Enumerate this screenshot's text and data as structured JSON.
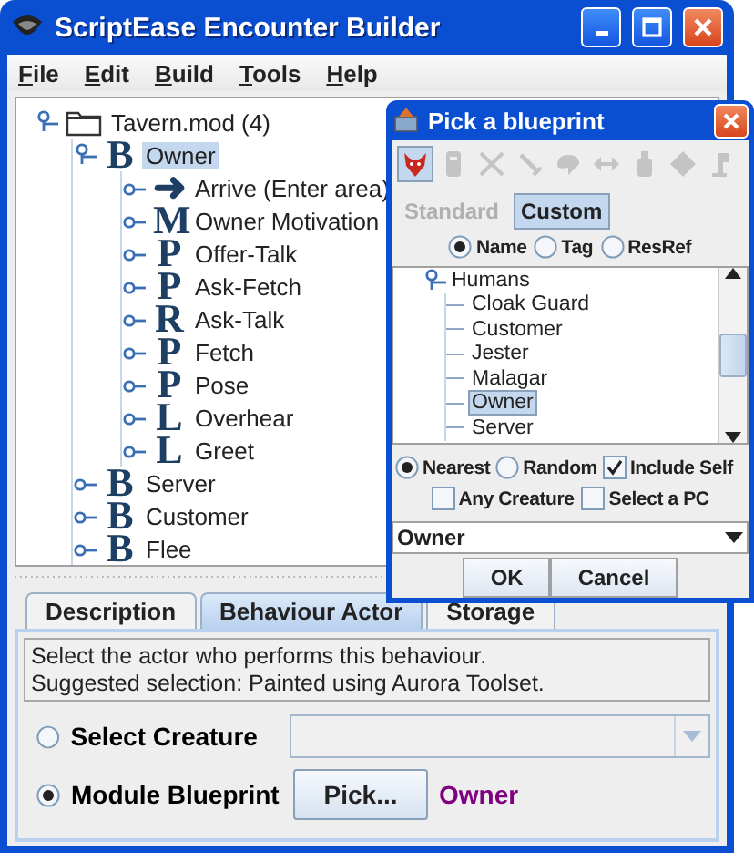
{
  "window": {
    "title": "ScriptEase Encounter Builder"
  },
  "menu": [
    "File",
    "Edit",
    "Build",
    "Tools",
    "Help"
  ],
  "tree": {
    "label": "Tavern.mod (4)",
    "kind": "folder",
    "expanded": true,
    "selected": false,
    "children": [
      {
        "label": "Owner",
        "kind": "glyph",
        "glyph": "B",
        "expanded": true,
        "selected": true,
        "children": [
          {
            "label": "Arrive (Enter area)",
            "kind": "glyph",
            "glyph": "➜",
            "expanded": false,
            "selected": false
          },
          {
            "label": "Owner Motivation",
            "kind": "glyph",
            "glyph": "M",
            "expanded": false,
            "selected": false
          },
          {
            "label": "Offer-Talk",
            "kind": "glyph",
            "glyph": "P",
            "expanded": false,
            "selected": false
          },
          {
            "label": "Ask-Fetch",
            "kind": "glyph",
            "glyph": "P",
            "expanded": false,
            "selected": false
          },
          {
            "label": "Ask-Talk",
            "kind": "glyph",
            "glyph": "R",
            "expanded": false,
            "selected": false
          },
          {
            "label": "Fetch",
            "kind": "glyph",
            "glyph": "P",
            "expanded": false,
            "selected": false
          },
          {
            "label": "Pose",
            "kind": "glyph",
            "glyph": "P",
            "expanded": false,
            "selected": false
          },
          {
            "label": "Overhear",
            "kind": "glyph",
            "glyph": "L",
            "expanded": false,
            "selected": false
          },
          {
            "label": "Greet",
            "kind": "glyph",
            "glyph": "L",
            "expanded": false,
            "selected": false
          }
        ]
      },
      {
        "label": "Server",
        "kind": "glyph",
        "glyph": "B",
        "expanded": false,
        "selected": false
      },
      {
        "label": "Customer",
        "kind": "glyph",
        "glyph": "B",
        "expanded": false,
        "selected": false
      },
      {
        "label": "Flee",
        "kind": "glyph",
        "glyph": "B",
        "expanded": false,
        "selected": false
      }
    ]
  },
  "tabs": [
    {
      "label": "Description",
      "selected": false
    },
    {
      "label": "Behaviour Actor",
      "selected": true
    },
    {
      "label": "Storage",
      "selected": false
    }
  ],
  "description": [
    "Select the actor who performs this behaviour.",
    "Suggested selection: Painted using Aurora Toolset."
  ],
  "actor_options": [
    {
      "label": "Select Creature",
      "kind": "combo",
      "selected": false,
      "disabled": true
    },
    {
      "label": "Module Blueprint",
      "kind": "blueprint",
      "selected": true,
      "button": "Pick...",
      "value": "Owner"
    }
  ],
  "dialog": {
    "title": "Pick a blueprint",
    "toolbar": [
      {
        "kind": "creature",
        "selected": true,
        "disabled": false
      },
      {
        "kind": "door",
        "selected": false,
        "disabled": true
      },
      {
        "kind": "swords",
        "selected": false,
        "disabled": true
      },
      {
        "kind": "sword",
        "selected": false,
        "disabled": true
      },
      {
        "kind": "cloud",
        "selected": false,
        "disabled": true
      },
      {
        "kind": "arrows",
        "selected": false,
        "disabled": true
      },
      {
        "kind": "bag",
        "selected": false,
        "disabled": true
      },
      {
        "kind": "diamond",
        "selected": false,
        "disabled": true
      },
      {
        "kind": "figure",
        "selected": false,
        "disabled": true
      }
    ],
    "modes": [
      {
        "label": "Standard",
        "selected": false
      },
      {
        "label": "Custom",
        "selected": true
      }
    ],
    "search_by": [
      {
        "label": "Name",
        "selected": true
      },
      {
        "label": "Tag",
        "selected": false
      },
      {
        "label": "ResRef",
        "selected": false
      }
    ],
    "list": {
      "label": "Humans",
      "expanded": true,
      "selected": false,
      "children": [
        {
          "label": "Cloak Guard",
          "selected": false
        },
        {
          "label": "Customer",
          "selected": false
        },
        {
          "label": "Jester",
          "selected": false
        },
        {
          "label": "Malagar",
          "selected": false
        },
        {
          "label": "Owner",
          "selected": true
        },
        {
          "label": "Server",
          "selected": false
        }
      ]
    },
    "scope": [
      {
        "label": "Nearest",
        "selected": true
      },
      {
        "label": "Random",
        "selected": false
      }
    ],
    "options": [
      {
        "label": "Include Self",
        "checked": true
      },
      {
        "label": "Any Creature",
        "checked": false
      },
      {
        "label": "Select a PC",
        "checked": false
      }
    ],
    "value": "Owner",
    "buttons": [
      "OK",
      "Cancel"
    ]
  }
}
